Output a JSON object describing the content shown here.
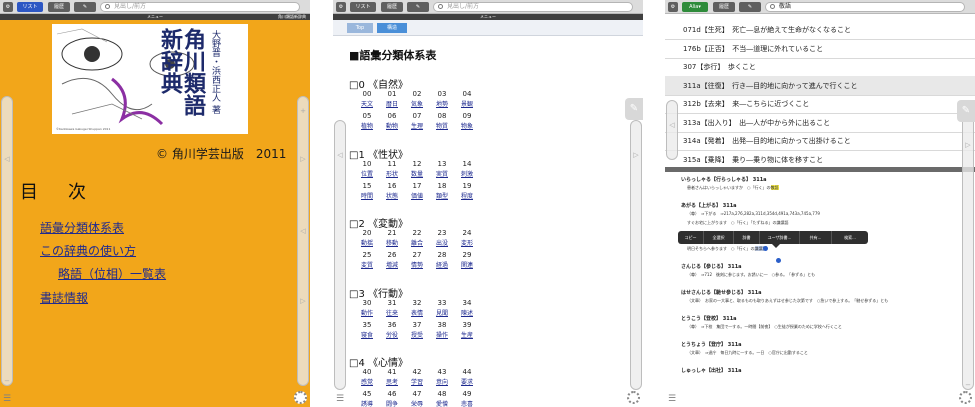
{
  "toolbar": {
    "list_button": "リスト",
    "history_button": "履歴",
    "search_placeholder": "見出し/前方",
    "alias_button": "Alia▾",
    "search_value": "敬語"
  },
  "strip_title": "メニュー",
  "strip_right": "角川類語新辞典",
  "screen1": {
    "cover_title": "角川類語新辞典",
    "cover_author": "大野晋・浜西正人 著",
    "cover_copyright": "©Kadokawa Gakugei Shuppan 2011",
    "publisher": "© 角川学芸出版　2011",
    "toc_title": "目　次",
    "links": [
      "語彙分類体系表",
      "この辞典の使い方",
      "略語（位相）一覧表",
      "書誌情報"
    ]
  },
  "screen2": {
    "crumbs": [
      "Top",
      "構造"
    ],
    "title": "■語彙分類体系表",
    "sections": [
      {
        "head": "□0 《自然》",
        "items": [
          [
            "00",
            "天文"
          ],
          [
            "01",
            "暦日"
          ],
          [
            "02",
            "気象"
          ],
          [
            "03",
            "地勢"
          ],
          [
            "04",
            "景観"
          ],
          [
            "05",
            "植物"
          ],
          [
            "06",
            "動物"
          ],
          [
            "07",
            "生理"
          ],
          [
            "08",
            "物質"
          ],
          [
            "09",
            "物象"
          ]
        ]
      },
      {
        "head": "□1 《性状》",
        "items": [
          [
            "10",
            "位置"
          ],
          [
            "11",
            "形状"
          ],
          [
            "12",
            "数量"
          ],
          [
            "13",
            "実質"
          ],
          [
            "14",
            "刺激"
          ],
          [
            "15",
            "時間"
          ],
          [
            "16",
            "状態"
          ],
          [
            "17",
            "価値"
          ],
          [
            "18",
            "類型"
          ],
          [
            "19",
            "程度"
          ]
        ]
      },
      {
        "head": "□2 《変動》",
        "items": [
          [
            "20",
            "動揺"
          ],
          [
            "21",
            "移動"
          ],
          [
            "22",
            "離合"
          ],
          [
            "23",
            "出没"
          ],
          [
            "24",
            "変形"
          ],
          [
            "25",
            "変質"
          ],
          [
            "26",
            "増減"
          ],
          [
            "27",
            "情勢"
          ],
          [
            "28",
            "経過"
          ],
          [
            "29",
            "関連"
          ]
        ]
      },
      {
        "head": "□3 《行動》",
        "items": [
          [
            "30",
            "動作"
          ],
          [
            "31",
            "往来"
          ],
          [
            "32",
            "表情"
          ],
          [
            "33",
            "見聞"
          ],
          [
            "34",
            "陳述"
          ],
          [
            "35",
            "寝食"
          ],
          [
            "36",
            "労役"
          ],
          [
            "37",
            "授受"
          ],
          [
            "38",
            "操作"
          ],
          [
            "39",
            "生産"
          ]
        ]
      },
      {
        "head": "□4 《心情》",
        "items": [
          [
            "40",
            "感覚"
          ],
          [
            "41",
            "思考"
          ],
          [
            "42",
            "学習"
          ],
          [
            "43",
            "意向"
          ],
          [
            "44",
            "要求"
          ],
          [
            "45",
            "誘導"
          ],
          [
            "46",
            "闘争"
          ],
          [
            "47",
            "栄辱"
          ],
          [
            "48",
            "愛憎"
          ],
          [
            "49",
            "悲喜"
          ]
        ]
      }
    ]
  },
  "screen3": {
    "rows": [
      {
        "text": "071d【生死】　死亡―息が絶えて生命がなくなること",
        "sel": false
      },
      {
        "text": "176b【正否】　不当―道理に外れていること",
        "sel": false
      },
      {
        "text": "307【歩行】　歩くこと",
        "sel": false
      },
      {
        "text": "311a【往復】　行き―目的地に向かって進んで行くこと",
        "sel": true
      },
      {
        "text": "312b【去来】　来―こちらに近づくこと",
        "sel": false
      },
      {
        "text": "313a【出入り】　出―人が中から外に出ること",
        "sel": false
      },
      {
        "text": "314a【発着】　出発―目的地に向かって出掛けること",
        "sel": false
      },
      {
        "text": "315a【乗降】　乗り―乗り物に体を移すこと",
        "sel": false
      }
    ],
    "entries": [
      {
        "head": "いらっしゃる【行らっしゃる】 311a",
        "body": "患者さんはいらっしゃいますか　○「行く」の",
        "hl": "敬語"
      },
      {
        "head": "あがる【上がる】 311a",
        "body": "（尊）　⇒下がる　⇒217a,276,282a,311d,354d,491a,743a,745a,779",
        "hl": ""
      },
      {
        "head": "",
        "body": "すぐお宅に上がります　○「行く」「たずねる」の謙譲語",
        "hl": ""
      },
      {
        "head": "",
        "body": "（尊）　⇒312b,466a,492a,768",
        "hl": ""
      },
      {
        "head": "",
        "body": "明日そちらへ参ります　○「行く」の",
        "hl": "謙譲語"
      },
      {
        "head": "さんじる【参じる】 311a",
        "body": "（尊）　⇒712　後刻に参じます。お誘いに―　○参る。「参ずる」とも",
        "hl": ""
      },
      {
        "head": "はせさんじる【馳せ参じる】 311a",
        "body": "（文章）　お家の一大事と、取るものも取りあえずはせ参じた次第です　○急いで参上する。「馳せ参ずる」とも",
        "hl": ""
      },
      {
        "head": "とうこう【登校】 311a",
        "body": "（尊）　⇒下校　集団で―する。一時間【前夜】　○生徒が授業のために学校へ行くこと",
        "hl": ""
      },
      {
        "head": "とうちょう【登庁】 311a",
        "body": "（文章）　⇒退庁　毎日九時に―する。一日　○官庁に出勤すること",
        "hl": ""
      },
      {
        "head": "しゅっしゃ【出社】 311a",
        "body": "",
        "hl": ""
      }
    ],
    "context_menu": [
      "コピー",
      "全選択",
      "辞書",
      "ユーザ辞書...",
      "共有...",
      "検索..."
    ]
  }
}
